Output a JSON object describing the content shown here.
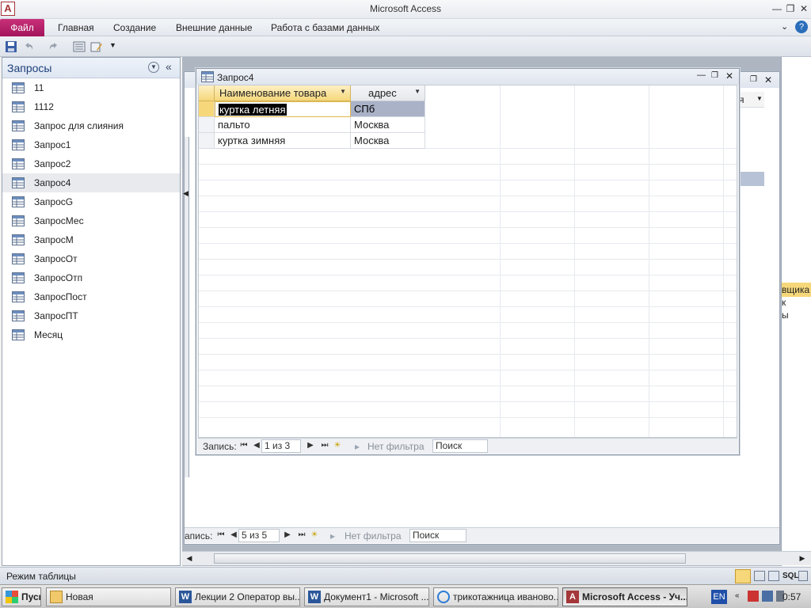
{
  "window": {
    "title": "Microsoft Access",
    "app_icon_letter": "A"
  },
  "ribbon": {
    "tabs": [
      "Файл",
      "Главная",
      "Создание",
      "Внешние данные",
      "Работа с базами данных"
    ]
  },
  "nav": {
    "title": "Запросы",
    "items": [
      "11",
      "1112",
      "Запрос для слияния",
      "Запрос1",
      "Запрос2",
      "Запрос4",
      "ЗапросG",
      "ЗапросМес",
      "ЗапросМ",
      "ЗапросОт",
      "ЗапросОтп",
      "ЗапросПост",
      "ЗапросПТ",
      "Месяц"
    ],
    "selected": "Запрос4"
  },
  "query_window": {
    "title": "Запрос4",
    "columns": [
      "Наименование товара",
      "адрес"
    ],
    "rows": [
      [
        "куртка летняя",
        "СПб"
      ],
      [
        "пальто",
        "Москва"
      ],
      [
        "куртка зимняя",
        "Москва"
      ]
    ],
    "record_bar": {
      "label": "Запись:",
      "position": "1 из 3",
      "filter": "Нет фильтра",
      "search": "Поиск"
    }
  },
  "background_window": {
    "record_bar": {
      "label": "апись:",
      "position": "5 из 5",
      "filter": "Нет фильтра",
      "search": "Поиск"
    },
    "col_fragment": "я",
    "panel_fragment": "вщика",
    "panel_lines": [
      "к",
      "ы"
    ]
  },
  "status": {
    "mode": "Режим таблицы",
    "view_sql": "SQL"
  },
  "taskbar": {
    "start": "Пуск",
    "buttons": [
      "Новая",
      "Лекции 2 Оператор вы...",
      "Документ1 - Microsoft ...",
      "трикотажница иваново...",
      "Microsoft Access - Уч..."
    ],
    "lang": "EN",
    "time": "0:57"
  },
  "colors": {
    "file_tab": "#b0186a",
    "header_yellow": "#f6d77a",
    "selected_cell": "#aab2c8"
  }
}
